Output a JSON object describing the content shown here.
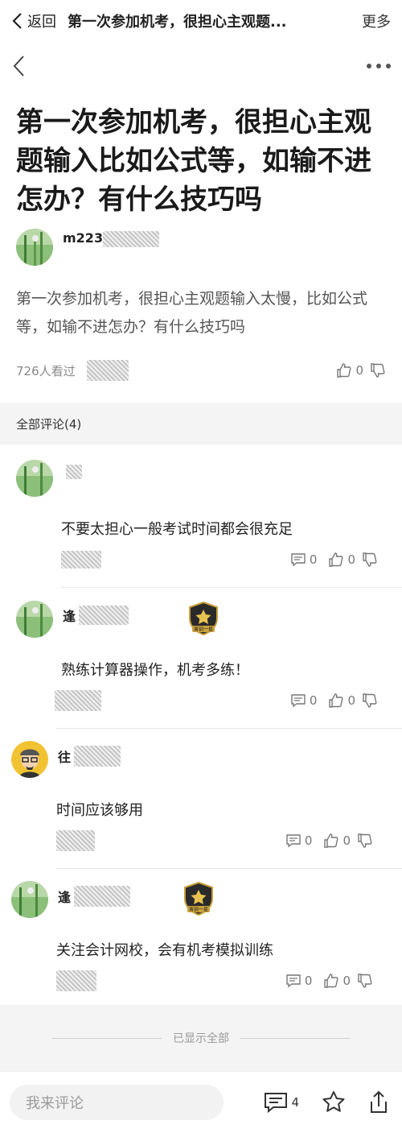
{
  "topbar": {
    "back_label": "返回",
    "title": "第一次参加机考，很担心主观题...",
    "more_label": "更多"
  },
  "post": {
    "title": "第一次参加机考，很担心主观题输入比如公式等，如输不进怎办？有什么技巧吗",
    "author": "m223",
    "content": "第一次参加机考，很担心主观题输入太慢，比如公式等，如输不进怎办？有什么技巧吗",
    "views": "726人看过",
    "likes": "0"
  },
  "comments_header": "全部评论(4)",
  "comments": [
    {
      "name": "",
      "text": "不要太担心一般考试时间都会很充足",
      "replies": "0",
      "likes": "0",
      "badge": false,
      "avatar": "scenery"
    },
    {
      "name": "逢",
      "text": "熟练计算器操作，机考多练！",
      "replies": "0",
      "likes": "0",
      "badge": true,
      "badge_text": "青铜一星",
      "avatar": "scenery"
    },
    {
      "name": "往",
      "text": "时间应该够用",
      "replies": "0",
      "likes": "0",
      "badge": false,
      "avatar": "cartoon"
    },
    {
      "name": "逢",
      "text": "关注会计网校，会有机考模拟训练",
      "replies": "0",
      "likes": "0",
      "badge": true,
      "badge_text": "青铜一星",
      "avatar": "scenery"
    }
  ],
  "end_text": "已显示全部",
  "bottom": {
    "placeholder": "我来评论",
    "comment_count": "4"
  },
  "colors": {
    "badge_gold": "#c9a03a",
    "badge_dark": "#2a2a2a",
    "avatar_green": "#6aa35a",
    "section_bg": "#f4f4f4"
  }
}
